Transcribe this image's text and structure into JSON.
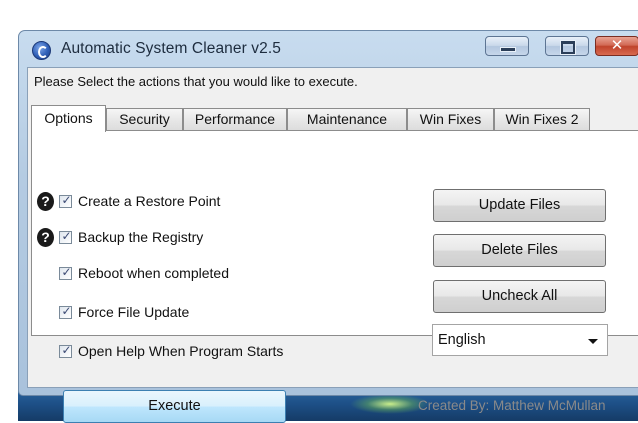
{
  "window": {
    "title": "Automatic System Cleaner v2.5",
    "instruction": "Please Select the actions that you would like to execute."
  },
  "tabs": [
    {
      "label": "Options",
      "active": true
    },
    {
      "label": "Security",
      "active": false
    },
    {
      "label": "Performance",
      "active": false
    },
    {
      "label": "Maintenance",
      "active": false
    },
    {
      "label": "Win Fixes",
      "active": false
    },
    {
      "label": "Win Fixes 2",
      "active": false
    }
  ],
  "options": [
    {
      "label": "Create a Restore Point",
      "checked": true,
      "help_icon": true
    },
    {
      "label": "Backup the Registry",
      "checked": true,
      "help_icon": true
    },
    {
      "label": "Reboot when completed",
      "checked": true,
      "help_icon": false
    },
    {
      "label": "Force File Update",
      "checked": true,
      "help_icon": false
    },
    {
      "label": "Open Help When Program Starts",
      "checked": true,
      "help_icon": false
    }
  ],
  "buttons": {
    "update_files": "Update Files",
    "delete_files": "Delete Files",
    "uncheck_all": "Uncheck All",
    "execute": "Execute"
  },
  "language_select": {
    "value": "English"
  },
  "credit": "Created By: Matthew McMullan",
  "icons": {
    "app": "cleaner-app-icon",
    "help": "help-icon",
    "check": "checkmark-icon",
    "dropdown": "chevron-down-icon"
  },
  "colors": {
    "titlebar": "#b4cbe2",
    "close_button": "#c0432c",
    "execute_button": "#bee6fd",
    "panel": "#ffffff"
  }
}
